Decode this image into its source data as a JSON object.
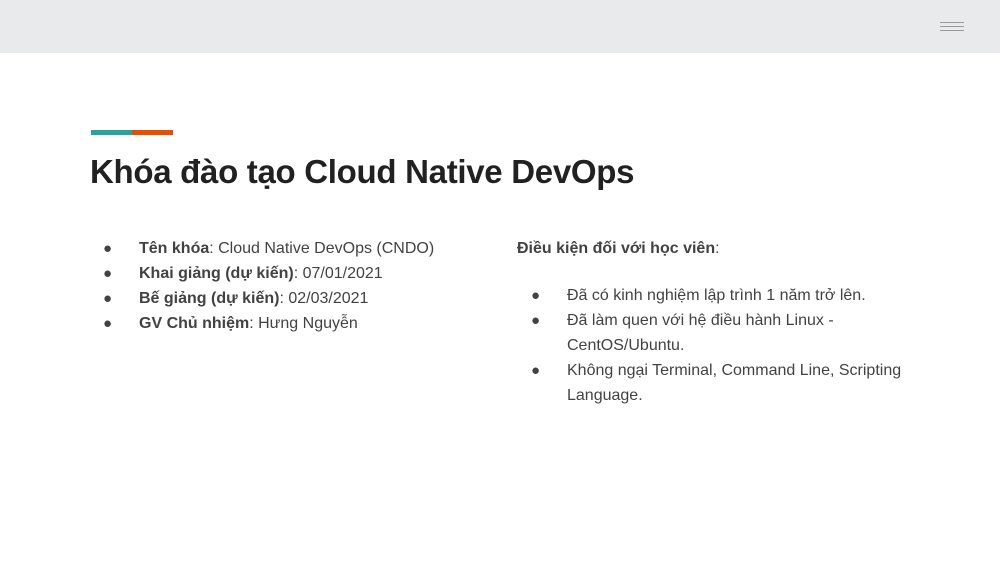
{
  "colors": {
    "accent_teal": "#26a69a",
    "accent_orange": "#e65100"
  },
  "menu": {
    "icon": "hamburger-icon"
  },
  "title": "Khóa đào tạo Cloud Native DevOps",
  "course_info": [
    {
      "label": "Tên khóa",
      "value": ": Cloud Native DevOps (CNDO)"
    },
    {
      "label": "Khai giảng (dự kiến)",
      "value": ": 07/01/2021"
    },
    {
      "label": "Bế giảng (dự kiến)",
      "value": ": 02/03/2021"
    },
    {
      "label": "GV Chủ nhiệm",
      "value": ": Hưng Nguyễn"
    }
  ],
  "requirements": {
    "heading": "Điều kiện đối với học viên",
    "heading_suffix": ":",
    "items": [
      "Đã có kinh nghiệm lập trình 1 năm trở lên.",
      "Đã làm quen với hệ điều hành Linux - CentOS/Ubuntu.",
      "Không ngại Terminal, Command Line, Scripting Language."
    ]
  },
  "bullet_glyph": "●"
}
